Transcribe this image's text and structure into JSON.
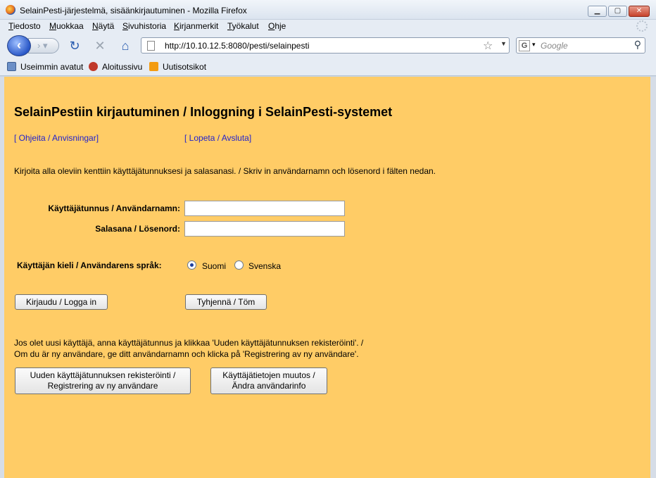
{
  "window": {
    "title": "SelainPesti-järjestelmä, sisäänkirjautuminen - Mozilla Firefox"
  },
  "menu": [
    "Tiedosto",
    "Muokkaa",
    "Näytä",
    "Sivuhistoria",
    "Kirjanmerkit",
    "Työkalut",
    "Ohje"
  ],
  "navbar": {
    "url": "http://10.10.12.5:8080/pesti/selainpesti",
    "search_placeholder": "Google"
  },
  "bookmarks": [
    "Useimmin avatut",
    "Aloitussivu",
    "Uutisotsikot"
  ],
  "page": {
    "heading": "SelainPestiin kirjautuminen / Inloggning i SelainPesti-systemet",
    "help_link": "[ Ohjeita / Anvisningar]",
    "quit_link": "[ Lopeta / Avsluta]",
    "instructions": "Kirjoita alla oleviin kenttiin käyttäjätunnuksesi ja salasanasi. / Skriv in användarnamn och lösenord i fälten nedan.",
    "username_label": "Käyttäjätunnus / Användarnamn:",
    "username_value": "",
    "password_label": "Salasana / Lösenord:",
    "password_value": "",
    "language_label": "Käyttäjän kieli / Användarens språk:",
    "language_options": [
      "Suomi",
      "Svenska"
    ],
    "language_selected": "Suomi",
    "login_button": "Kirjaudu / Logga in",
    "clear_button": "Tyhjennä / Töm",
    "new_user_line1": "Jos olet uusi käyttäjä, anna käyttäjätunnus ja klikkaa 'Uuden käyttäjätunnuksen rekisteröinti'. /",
    "new_user_line2": "Om du är ny användare, ge ditt användarnamn och klicka på 'Registrering av ny användare'.",
    "register_button_line1": "Uuden käyttäjätunnuksen rekisteröinti /",
    "register_button_line2": "Registrering av ny användare",
    "modify_button_line1": "Käyttäjätietojen muutos /",
    "modify_button_line2": "Ändra användarinfo"
  },
  "colors": {
    "page_background": "#ffcc66",
    "link": "#2222cc"
  }
}
